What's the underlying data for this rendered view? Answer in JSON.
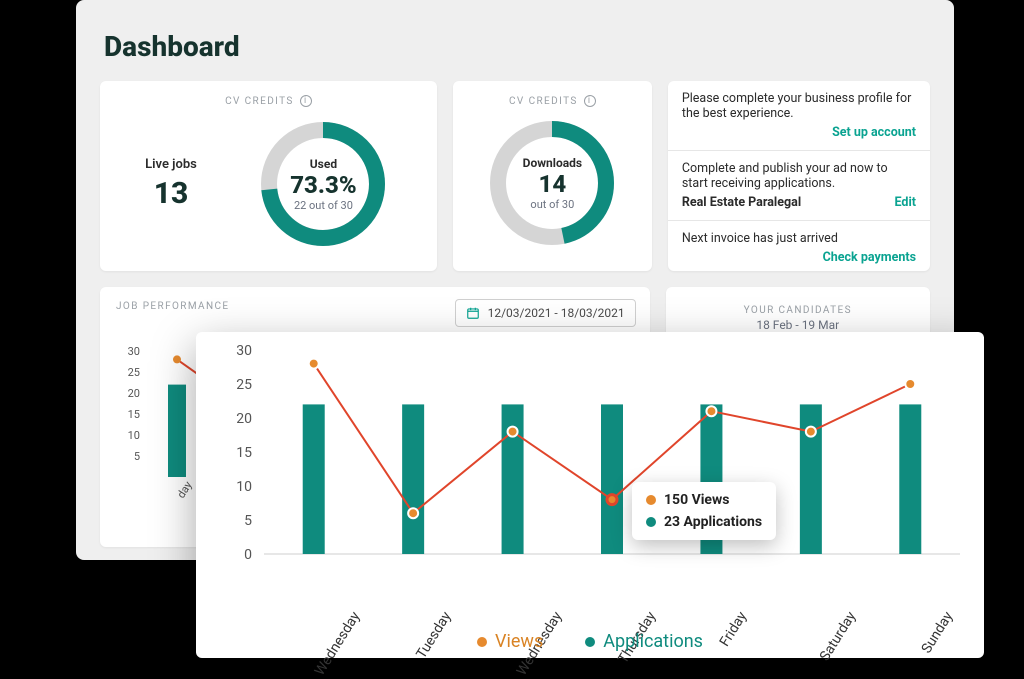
{
  "page": {
    "title": "Dashboard"
  },
  "colors": {
    "teal": "#0f8b7e",
    "orange": "#e68a2e",
    "red": "#e0452b",
    "grey": "#d5d5d5"
  },
  "credits": {
    "header_label": "CV CREDITS",
    "live_jobs_label": "Live jobs",
    "live_jobs_value": "13",
    "used_label": "Used",
    "used_percent": "73.3%",
    "used_sub": "22 out of 30",
    "used_fraction": 0.733
  },
  "downloads": {
    "header_label": "CV CREDITS",
    "label": "Downloads",
    "value": "14",
    "sub": "out of 30",
    "fraction": 0.467
  },
  "notices": {
    "n1_text": "Please complete your business profile for the best experience.",
    "n1_link": "Set up account",
    "n2_text": "Complete and publish your ad now to start receiving applications.",
    "n2_job": "Real Estate Paralegal",
    "n2_link": "Edit",
    "n3_text": "Next invoice has just arrived",
    "n3_link": "Check payments"
  },
  "jobperf": {
    "title": "JOB PERFORMANCE",
    "date_range": "12/03/2021 - 18/03/2021"
  },
  "candidates": {
    "title": "YOUR CANDIDATES",
    "range": "18 Feb - 19 Mar"
  },
  "chart_data": {
    "type": "bar",
    "categories": [
      "Wednesday",
      "Tuesday",
      "Wednesday",
      "Thursday",
      "Friday",
      "Saturday",
      "Sunday"
    ],
    "series": [
      {
        "name": "Applications",
        "kind": "bar",
        "values": [
          22,
          22,
          22,
          22,
          22,
          22,
          22
        ]
      },
      {
        "name": "Views",
        "kind": "line",
        "values": [
          28,
          6,
          18,
          8,
          21,
          18,
          25
        ]
      }
    ],
    "tooltip": {
      "index": 3,
      "views_label": "150 Views",
      "apps_label": "23 Applications"
    },
    "yticks": [
      0,
      5,
      10,
      15,
      20,
      25,
      30
    ],
    "ylim": [
      0,
      30
    ],
    "legend": {
      "views": "Views",
      "applications": "Applications"
    }
  },
  "mini_chart_data": {
    "yticks": [
      5,
      10,
      15,
      20,
      25,
      30
    ],
    "ylim": [
      0,
      30
    ],
    "bars": [
      22
    ],
    "line": [
      28,
      14
    ]
  }
}
